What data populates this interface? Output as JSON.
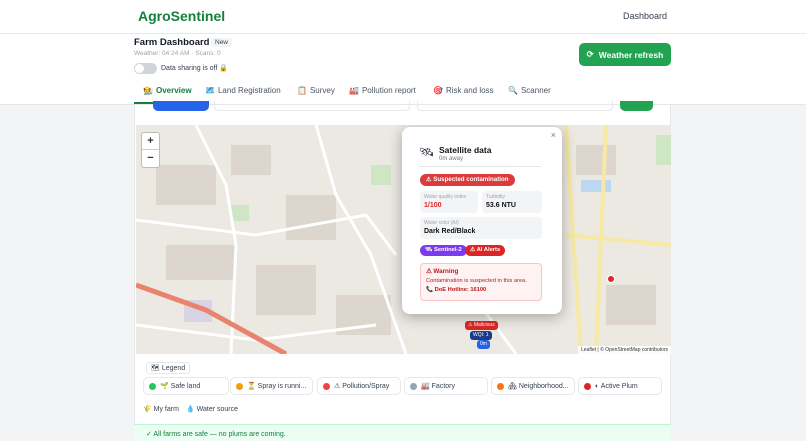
{
  "brand": "AgroSentinel",
  "nav": {
    "dashboard": "Dashboard"
  },
  "header": {
    "title": "Farm Dashboard",
    "badge": "New",
    "meta": "Weather: 04:24 AM · Scans: 0",
    "sharing": "Data sharing is off 🔒",
    "weather_btn": "Weather refresh"
  },
  "tabs": [
    {
      "icon": "🧑‍🌾",
      "label": "Overview"
    },
    {
      "icon": "🗺️",
      "label": "Land Registration"
    },
    {
      "icon": "📋",
      "label": "Survey"
    },
    {
      "icon": "🏭",
      "label": "Pollution report"
    },
    {
      "icon": "🎯",
      "label": "Risk and loss"
    },
    {
      "icon": "🔍",
      "label": "Scanner"
    }
  ],
  "map": {
    "zoom_in": "+",
    "zoom_out": "−",
    "attribution": "Leaflet | © OpenStreetMap contributors",
    "markers": {
      "malicious": "⚠ Malicious",
      "wqi": "WQI: 1",
      "small": "0m"
    }
  },
  "popup": {
    "close": "×",
    "title": "Satellite data",
    "subtitle": "0m away",
    "status": "⚠ Suspected contamination",
    "wqi_label": "Water quality index",
    "wqi_value": "1/100",
    "turbidity_label": "Turbidity",
    "turbidity_value": "53.6 NTU",
    "color_label": "Water color (AI)",
    "color_value": "Dark Red/Black",
    "tag1": "🛰 Sentinel-2",
    "tag2": "⚠ AI Alerts",
    "warning_title": "⚠ Warning",
    "warning_text": "Contamination is suspected in this area.",
    "warning_hotline": "📞 DoE Hotline: 16100"
  },
  "legend": {
    "title": "🗺 Legend",
    "items": [
      {
        "label": "🌱 Safe land",
        "color": "#22c55e"
      },
      {
        "label": "⏳ Spray is runni...",
        "color": "#f59e0b"
      },
      {
        "label": "⚠ Pollution/Spray",
        "color": "#ef4444"
      },
      {
        "label": "🏭 Factory",
        "color": "#94a3b8"
      },
      {
        "label": "🏘 Neighborhood...",
        "color": "#f97316"
      },
      {
        "label": "◐ Active Plum",
        "color": "#dc2626"
      }
    ],
    "my_farm": "🌾 My farm",
    "water": "💧 Water source"
  },
  "footer": "✓ All farms are safe — no plums are coming."
}
